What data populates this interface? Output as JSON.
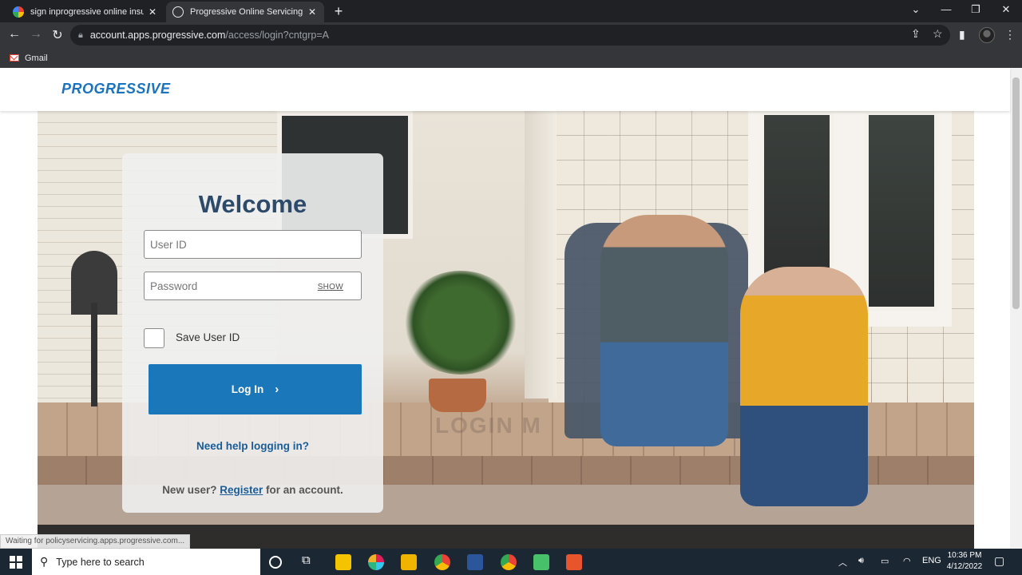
{
  "browser": {
    "tabs": [
      {
        "title": "sign inprogressive online insuran",
        "active": false
      },
      {
        "title": "Progressive Online Servicing",
        "active": true
      }
    ],
    "new_tab": "+",
    "url_host": "account.apps.progressive.com",
    "url_path": "/access/login?cntgrp=A",
    "bookmarks": [
      {
        "label": "Gmail"
      }
    ]
  },
  "page": {
    "logo": "PROGRESSIVE",
    "watermark": "LOGIN M",
    "login": {
      "heading": "Welcome",
      "user_placeholder": "User ID",
      "password_placeholder": "Password",
      "show_label": "SHOW",
      "save_label": "Save User ID",
      "login_label": "Log In",
      "help_link": "Need help logging in?",
      "new_user_prefix": "New user?",
      "register_link": "Register",
      "new_user_suffix": "for an account."
    },
    "status_text": "Waiting for policyservicing.apps.progressive.com..."
  },
  "taskbar": {
    "search_placeholder": "Type here to search",
    "language": "ENG",
    "time": "10:36 PM",
    "date": "4/12/2022"
  },
  "colors": {
    "brand_blue": "#1a77ba",
    "heading_navy": "#2d4a6b",
    "link_blue": "#1a5c96"
  }
}
